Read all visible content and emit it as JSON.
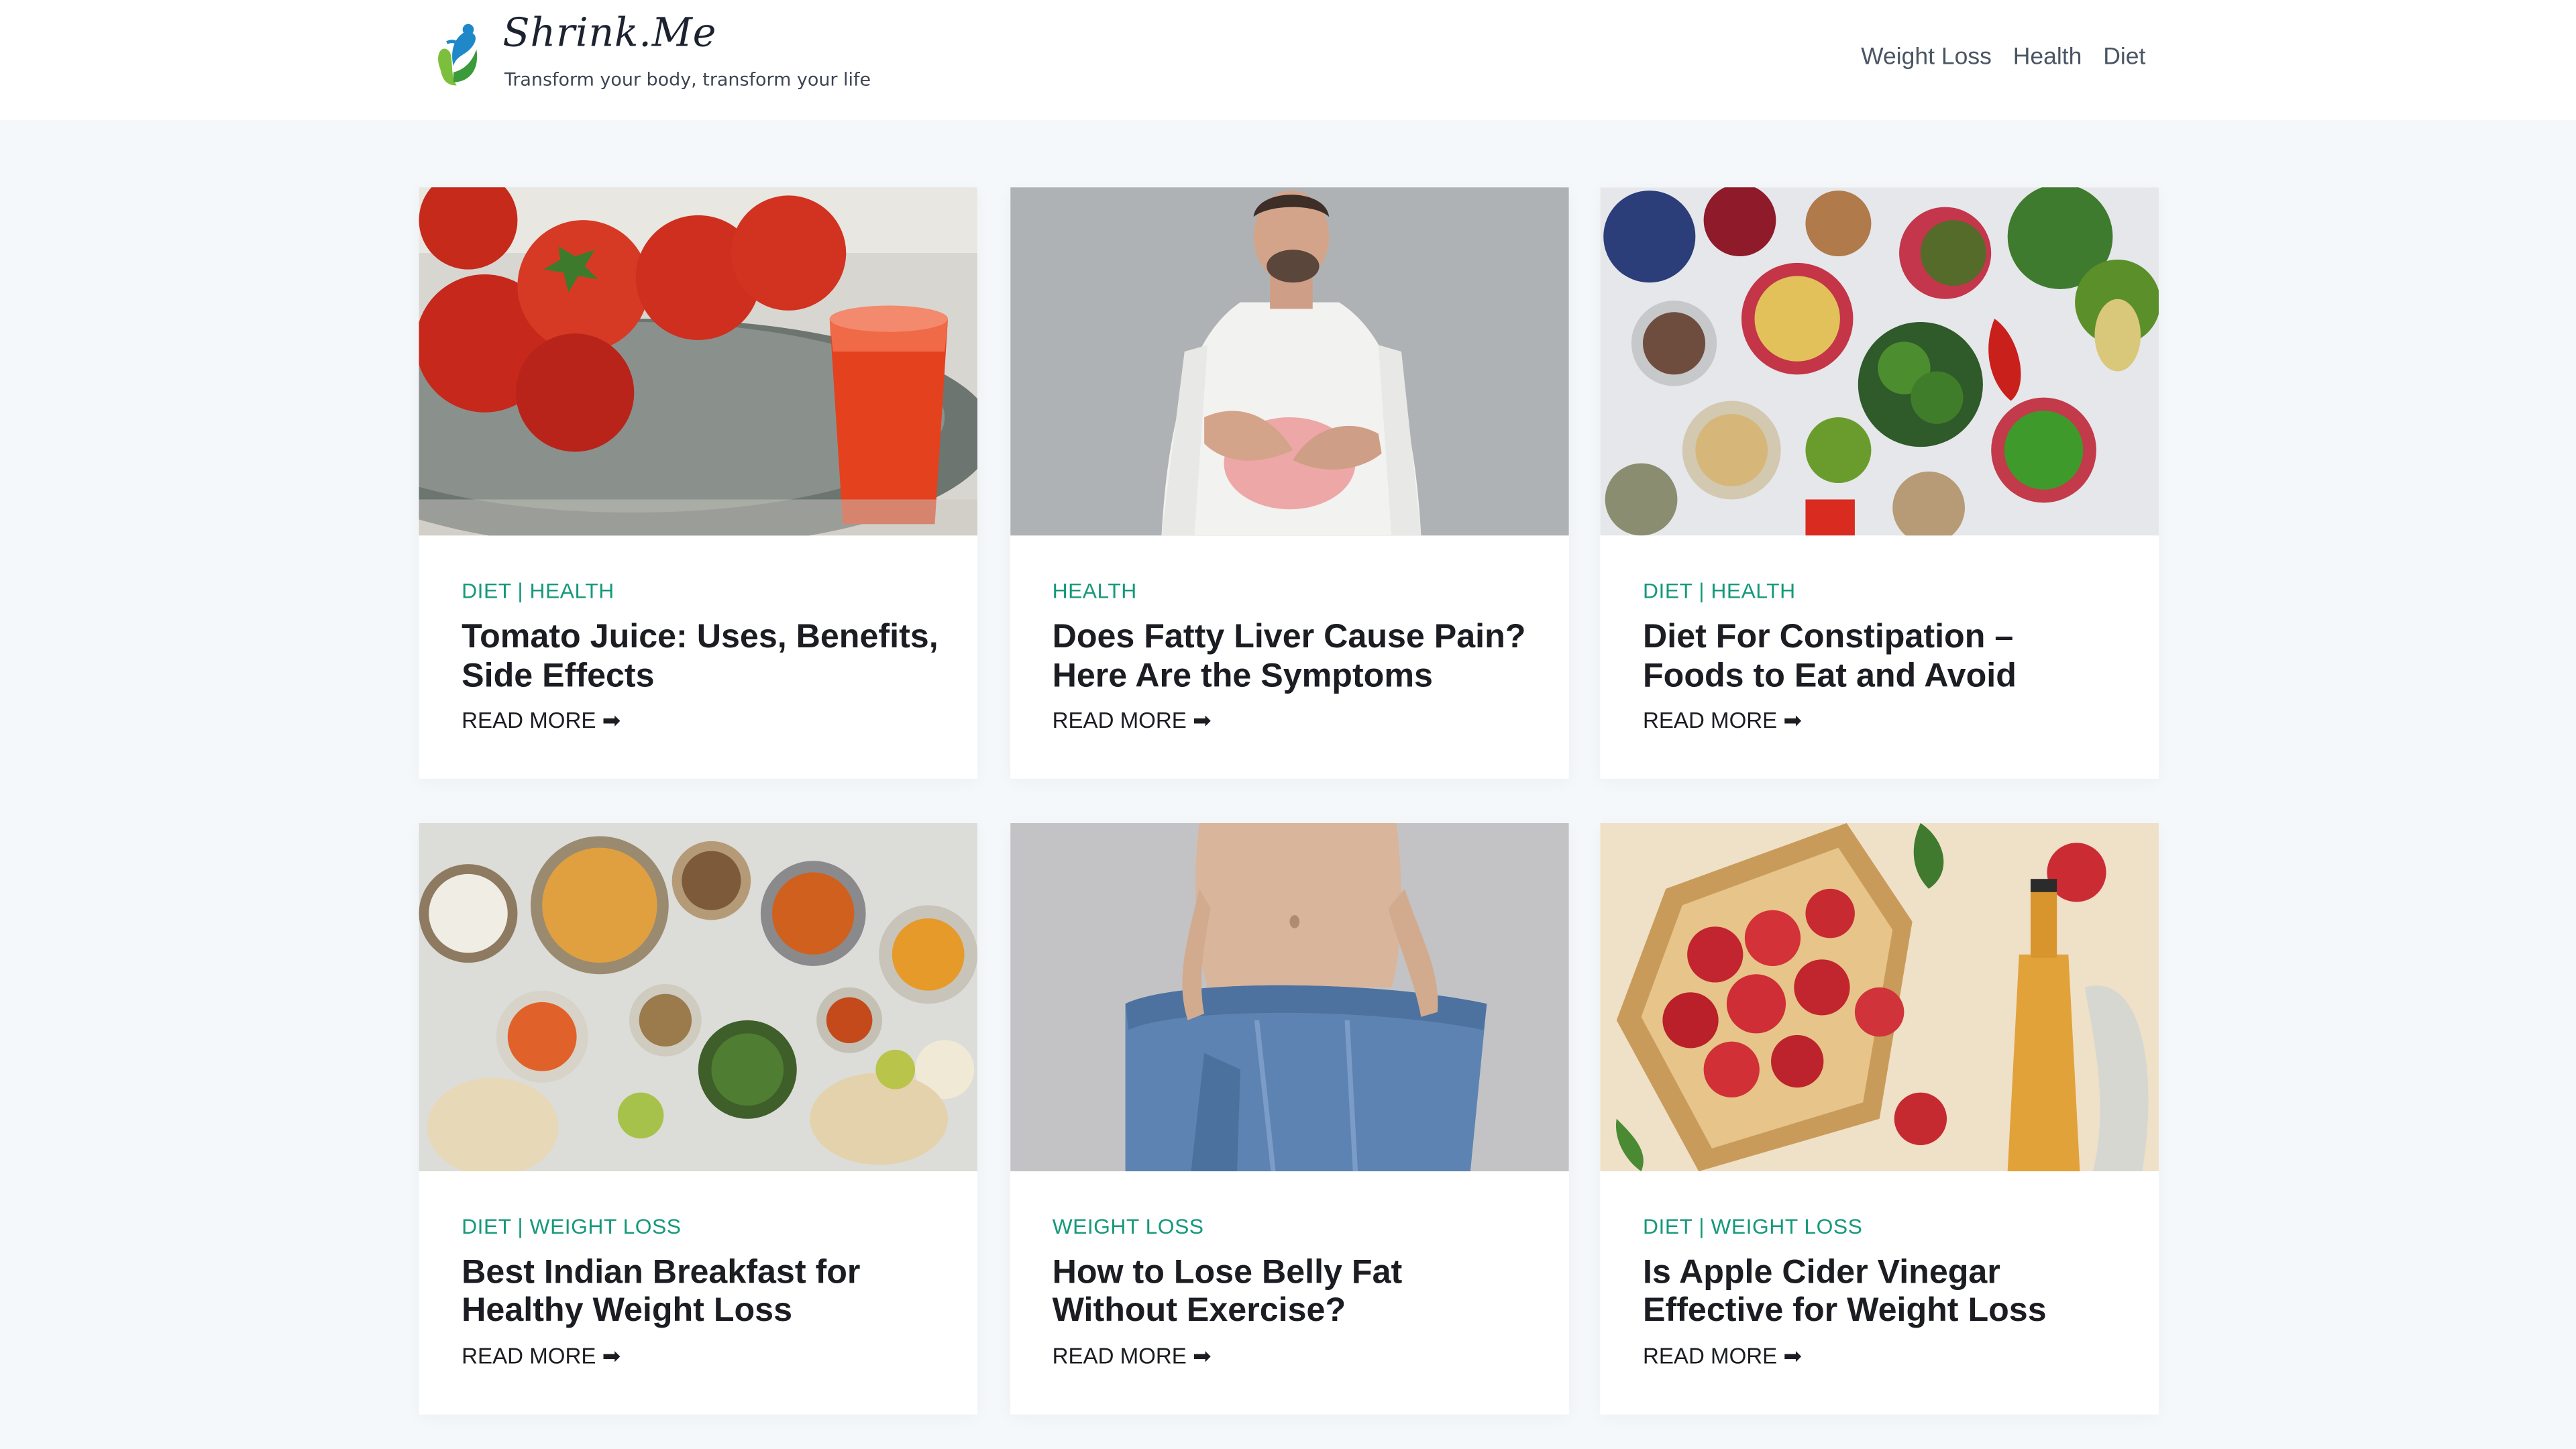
{
  "site": {
    "name": "Shrink.Me",
    "tagline": "Transform your body, transform your life",
    "logo_icon": "leaf-figure-icon",
    "accent_color": "#15997b"
  },
  "nav": {
    "items": [
      {
        "label": "Weight Loss"
      },
      {
        "label": "Health"
      },
      {
        "label": "Diet"
      }
    ]
  },
  "posts": [
    {
      "categories": [
        "Diet",
        "Health"
      ],
      "title": "Tomato Juice: Uses, Benefits, Side Effects",
      "read_more": "Read More ➡",
      "image": "tomato-juice-photo"
    },
    {
      "categories": [
        "Health"
      ],
      "title": "Does Fatty Liver Cause Pain? Here Are the Symptoms",
      "read_more": "Read More ➡",
      "image": "man-stomach-pain-photo"
    },
    {
      "categories": [
        "Diet",
        "Health"
      ],
      "title": "Diet For Constipation – Foods to Eat and Avoid",
      "read_more": "Read More ➡",
      "image": "healthy-foods-photo"
    },
    {
      "categories": [
        "Diet",
        "Weight Loss"
      ],
      "title": "Best Indian Breakfast for Healthy Weight Loss",
      "read_more": "Read More ➡",
      "image": "indian-food-photo"
    },
    {
      "categories": [
        "Weight Loss"
      ],
      "title": "How to Lose Belly Fat Without Exercise?",
      "read_more": "Read More ➡",
      "image": "loose-jeans-photo"
    },
    {
      "categories": [
        "Diet",
        "Weight Loss"
      ],
      "title": "Is Apple Cider Vinegar Effective for Weight Loss",
      "read_more": "Read More ➡",
      "image": "apples-vinegar-photo"
    }
  ],
  "separator": "|"
}
